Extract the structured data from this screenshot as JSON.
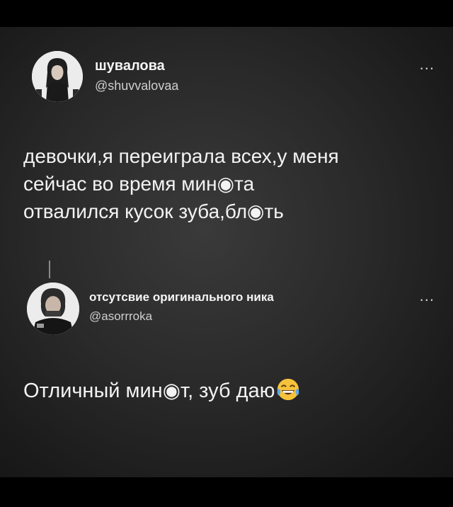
{
  "post1": {
    "name": "шувалова",
    "handle": "@shuvvalovaa",
    "more_label": "...",
    "text_lines": [
      "девочки,я переиграла всех,у меня",
      "сейчас во время мин◉та",
      "отвалился кусок зуба,бл◉ть"
    ]
  },
  "post2": {
    "name": "отсутсвие оригинального ника",
    "handle": "@asorrroka",
    "more_label": "...",
    "text": "Отличный мин◉т, зуб даю",
    "emoji_icon": "tears-of-joy-emoji"
  }
}
